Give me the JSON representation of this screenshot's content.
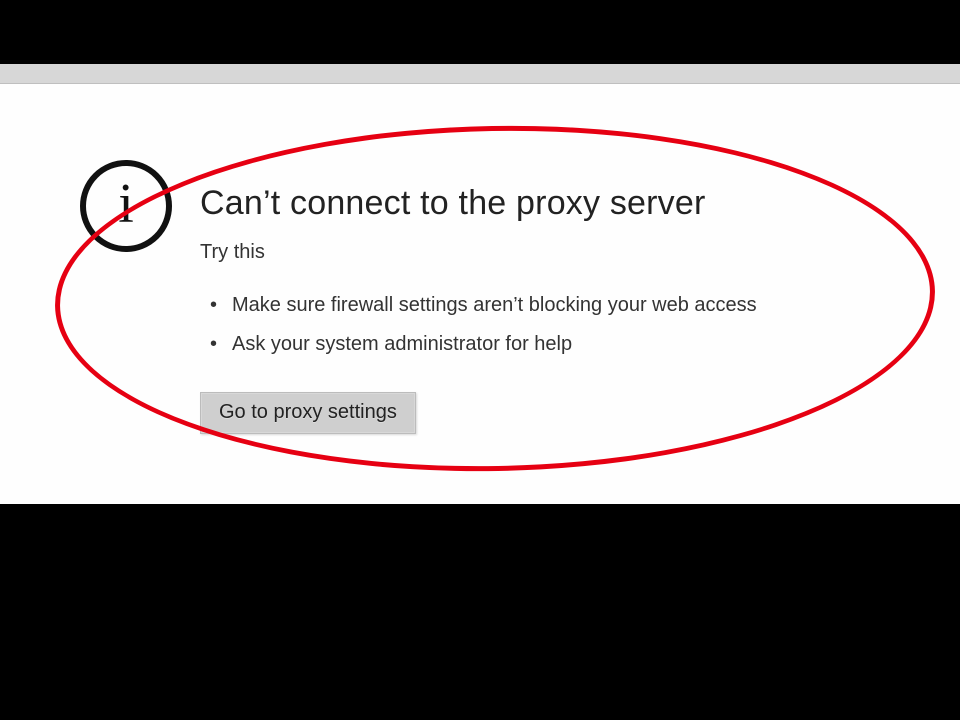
{
  "error": {
    "title": "Can’t connect to the proxy server",
    "subtitle": "Try this",
    "suggestions": [
      "Make sure firewall settings aren’t blocking your web access",
      "Ask your system administrator for help"
    ],
    "button_label": "Go to proxy settings",
    "info_glyph": "i"
  },
  "colors": {
    "annotation": "#e60012",
    "button_bg": "#cfcfcf"
  }
}
